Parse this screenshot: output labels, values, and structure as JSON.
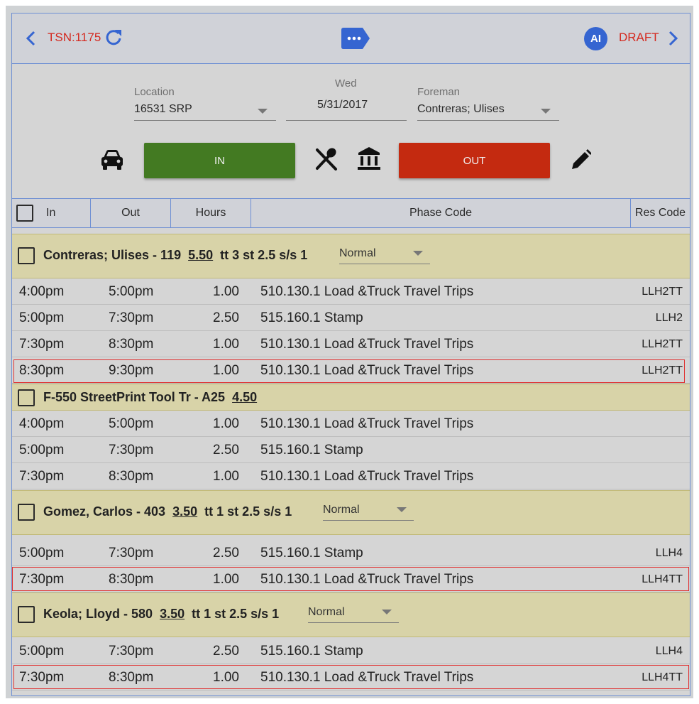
{
  "header": {
    "tsn": "TSN:1175",
    "avatar_initials": "AI",
    "status": "DRAFT"
  },
  "form": {
    "location_label": "Location",
    "location_value": "16531 SRP",
    "day_label": "Wed",
    "date_value": "5/31/2017",
    "foreman_label": "Foreman",
    "foreman_value": "Contreras; Ulises",
    "in_label": "IN",
    "out_label": "OUT"
  },
  "columns": {
    "in": "In",
    "out": "Out",
    "hours": "Hours",
    "phase": "Phase Code",
    "res": "Res Code"
  },
  "groups": [
    {
      "name": "Contreras; Ulises - 119",
      "hours": "5.50",
      "detail": "tt 3 st 2.5 s/s 1",
      "type": "Normal",
      "rows": [
        {
          "in": "4:00pm",
          "out": "5:00pm",
          "hours": "1.00",
          "phase": "510.130.1 Load &Truck Travel Trips",
          "res": "LLH2TT"
        },
        {
          "in": "5:00pm",
          "out": "7:30pm",
          "hours": "2.50",
          "phase": "515.160.1 Stamp",
          "res": "LLH2"
        },
        {
          "in": "7:30pm",
          "out": "8:30pm",
          "hours": "1.00",
          "phase": "510.130.1 Load &Truck Travel Trips",
          "res": "LLH2TT"
        },
        {
          "in": "8:30pm",
          "out": "9:30pm",
          "hours": "1.00",
          "phase": "510.130.1 Load &Truck Travel Trips",
          "res": "LLH2TT"
        }
      ]
    },
    {
      "name": "F-550 StreetPrint Tool Tr - A25",
      "hours": "4.50",
      "detail": "",
      "type": "",
      "rows": [
        {
          "in": "4:00pm",
          "out": "5:00pm",
          "hours": "1.00",
          "phase": "510.130.1 Load &Truck Travel Trips",
          "res": ""
        },
        {
          "in": "5:00pm",
          "out": "7:30pm",
          "hours": "2.50",
          "phase": "515.160.1 Stamp",
          "res": ""
        },
        {
          "in": "7:30pm",
          "out": "8:30pm",
          "hours": "1.00",
          "phase": "510.130.1 Load &Truck Travel Trips",
          "res": ""
        }
      ]
    },
    {
      "name": "Gomez, Carlos - 403",
      "hours": "3.50",
      "detail": "tt 1 st 2.5 s/s 1",
      "type": "Normal",
      "rows": [
        {
          "in": "5:00pm",
          "out": "7:30pm",
          "hours": "2.50",
          "phase": "515.160.1 Stamp",
          "res": "LLH4"
        },
        {
          "in": "7:30pm",
          "out": "8:30pm",
          "hours": "1.00",
          "phase": "510.130.1 Load &Truck Travel Trips",
          "res": "LLH4TT"
        }
      ]
    },
    {
      "name": "Keola; Lloyd - 580",
      "hours": "3.50",
      "detail": "tt 1 st 2.5 s/s 1",
      "type": "Normal",
      "rows": [
        {
          "in": "5:00pm",
          "out": "7:30pm",
          "hours": "2.50",
          "phase": "515.160.1 Stamp",
          "res": "LLH4"
        },
        {
          "in": "7:30pm",
          "out": "8:30pm",
          "hours": "1.00",
          "phase": "510.130.1 Load &Truck Travel Trips",
          "res": "LLH4TT"
        }
      ]
    }
  ],
  "colors": {
    "accent": "#3565d1",
    "in_button": "#437a22",
    "out_button": "#c42a10",
    "status_red": "#d42a20",
    "group_bg": "#d8d3a8"
  },
  "icons": [
    "chevron-left-icon",
    "refresh-icon",
    "chat-bubble-icon",
    "chevron-right-icon",
    "car-icon",
    "utensils-icon",
    "bank-icon",
    "pencil-icon"
  ]
}
